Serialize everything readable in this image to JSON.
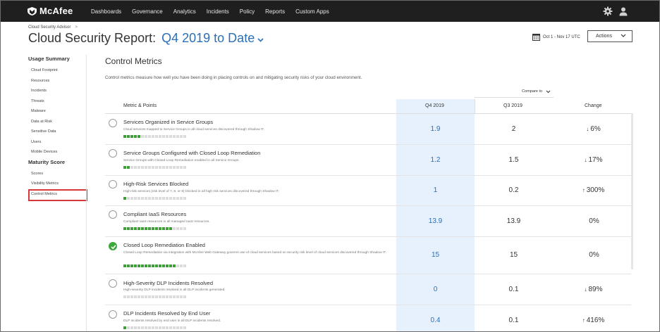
{
  "nav": {
    "logo": "McAfee",
    "items": [
      "Dashboards",
      "Governance",
      "Analytics",
      "Incidents",
      "Policy",
      "Reports",
      "Custom Apps"
    ]
  },
  "header": {
    "breadcrumb": "Cloud Security Advisor",
    "breadcrumb_sep": ">",
    "title": "Cloud Security Report:",
    "period": "Q4 2019 to Date",
    "date_range": "Oct 1 - Nov 17 UTC",
    "actions_label": "Actions"
  },
  "sidebar": {
    "usage_heading": "Usage Summary",
    "usage_items": [
      "Cloud Footprint",
      "Resources",
      "Incidents",
      "Threats",
      "Malware",
      "Data at Risk",
      "Sensitive Data",
      "Users",
      "Mobile Devices"
    ],
    "maturity_heading": "Maturity Score",
    "maturity_items": [
      "Scores",
      "Visibility Metrics",
      "Control Metrics"
    ],
    "active_item": "Control Metrics"
  },
  "main": {
    "title": "Control Metrics",
    "description": "Control metrics measure how well you have been doing in placing controls on and mitigating security risks of your cloud environment.",
    "compare_label": "Compare to",
    "columns": {
      "metric": "Metric & Points",
      "q4": "Q4 2019",
      "q3": "Q3 2019",
      "change": "Change"
    },
    "rows": [
      {
        "title": "Services Organized in Service Groups",
        "desc": "Cloud services mapped to Service Groups in all cloud services discovered through Shadow IT.",
        "q4": "1.9",
        "q3": "2",
        "change": "6%",
        "arrow": "↓",
        "done": false,
        "progress": 0.1,
        "segments": 5
      },
      {
        "title": "Service Groups Configured with Closed Loop Remediation",
        "desc": "Service Groups with Closed Loop Remediation enabled in all Service Groups.",
        "q4": "1.2",
        "q3": "1.5",
        "change": "17%",
        "arrow": "↓",
        "done": false,
        "progress": 0.06,
        "segments": 2
      },
      {
        "title": "High-Risk Services Blocked",
        "desc": "High-risk services (risk level of 7, 8, or 9) blocked in all high risk services discovered through Shadow IT.",
        "q4": "1",
        "q3": "0.2",
        "change": "300%",
        "arrow": "↑",
        "done": false,
        "progress": 0.05,
        "segments": 1
      },
      {
        "title": "Compliant IaaS Resources",
        "desc": "Compliant IaaS resources in all managed IaaS resources.",
        "q4": "13.9",
        "q3": "13.9",
        "change": "0%",
        "arrow": "",
        "done": false,
        "progress": 0.78,
        "segments": 14
      },
      {
        "title": "Closed Loop Remediation Enabled",
        "desc": "Closed Loop Remediation via integration with McAfee Web Gateway governs use of cloud services based on security risk level of cloud services discovered through Shadow IT.",
        "q4": "15",
        "q3": "15",
        "change": "0%",
        "arrow": "",
        "done": true,
        "progress": 1.0,
        "segments": 15
      },
      {
        "title": "High-Severity DLP Incidents Resolved",
        "desc": "High-severity DLP incidents resolved in all DLP incidents generated.",
        "q4": "0",
        "q3": "0.1",
        "change": "89%",
        "arrow": "↓",
        "done": false,
        "progress": 0.0,
        "segments": 0
      },
      {
        "title": "DLP Incidents Resolved by End User",
        "desc": "DLP incidents resolved by end user in all DLP incidents resolved.",
        "q4": "0.4",
        "q3": "0.1",
        "change": "416%",
        "arrow": "↑",
        "done": false,
        "progress": 0.03,
        "segments": 1
      }
    ]
  },
  "colors": {
    "accent": "#2a6fb7",
    "nav_bg": "#1f1f1f",
    "progress_on": "#3f9e3a",
    "check_done": "#3fa83c",
    "active_outline": "#d9383a",
    "q4_column_bg": "#e7f1fd"
  }
}
